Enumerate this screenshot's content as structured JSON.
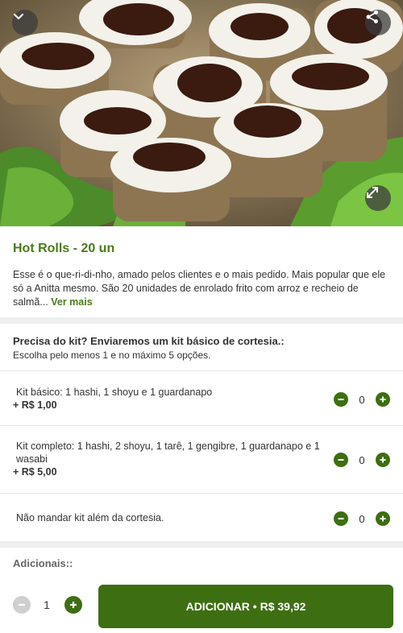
{
  "hero": {
    "image_alt": "Hot Rolls photo",
    "back_icon": "chevron-down-icon",
    "share_icon": "share-icon",
    "expand_icon": "expand-icon"
  },
  "product": {
    "title": "Hot Rolls - 20 un",
    "description": "Esse é o que-ri-di-nho, amado pelos clientes e o mais pedido. Mais popular que ele só a Anitta mesmo. São 20 unidades de enrolado frito com arroz e recheio de salmã...",
    "see_more": "Ver mais"
  },
  "kit_group": {
    "title": "Precisa do kit? Enviaremos um kit básico de cortesia.:",
    "subtitle": "Escolha pelo menos 1 e no máximo 5 opções.",
    "options": [
      {
        "label": "Kit básico: 1 hashi, 1 shoyu e 1 guardanapo",
        "price": "+ R$ 1,00",
        "qty": "0"
      },
      {
        "label": "Kit completo: 1 hashi, 2 shoyu, 1 tarê, 1 gengibre, 1 guardanapo e 1 wasabi",
        "price": "+ R$ 5,00",
        "qty": "0"
      },
      {
        "label": "Não mandar kit além da cortesia.",
        "price": "",
        "qty": "0"
      }
    ]
  },
  "addons": {
    "title": "Adicionais::"
  },
  "bottom_bar": {
    "quantity": "1",
    "add_label": "ADICIONAR • R$ 39,92"
  },
  "colors": {
    "brand_green": "#3d6f12",
    "title_green": "#4a7a1c",
    "disabled_grey": "#cfcfcf"
  }
}
